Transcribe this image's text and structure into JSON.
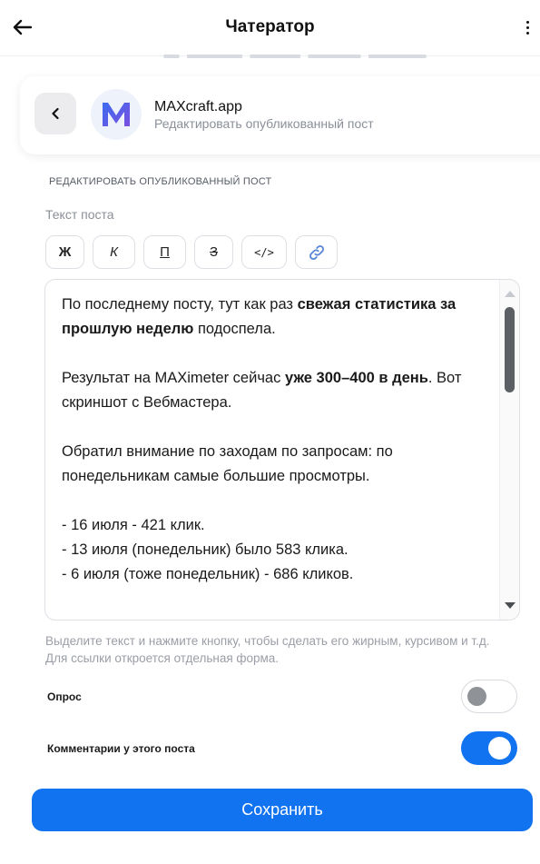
{
  "topbar": {
    "title": "Чатератор",
    "back_icon": "arrow-left-icon",
    "menu_icon": "kebab-menu-icon"
  },
  "card": {
    "back_icon": "chevron-left-icon",
    "logo_icon": "max-logo-icon",
    "name": "MAXcraft.app",
    "subtitle": "Редактировать опубликованный пост"
  },
  "section_label": "РЕДАКТИРОВАТЬ ОПУБЛИКОВАННЫЙ ПОСТ",
  "field_label": "Текст поста",
  "toolbar": {
    "bold": "Ж",
    "italic": "К",
    "underline": "П",
    "strike": "З",
    "code": "</>",
    "link_icon": "link-icon"
  },
  "post": {
    "p1_a": "По последнему посту, тут как раз ",
    "p1_b": "свежая статистика за прошлую неделю",
    "p1_c": " подоспела.",
    "p2_a": "Результат на MAXimeter сейчас ",
    "p2_b": "уже 300–400 в день",
    "p2_c": ". Вот скриншот с Вебмастера.",
    "p3": "Обратил внимание по заходам по запросам: по понедельникам самые большие просмотры.",
    "list": [
      "- 16 июля - 421 клик.",
      "- 13 июля (понедельник) было 583 клика.",
      "- 6 июля (тоже понедельник) - 686 кликов."
    ]
  },
  "hint": "Выделите текст и нажмите кнопку, чтобы сделать его жирным, курсивом и т.д. Для ссылки откроется отдельная форма.",
  "poll": {
    "label": "Опрос",
    "enabled": false
  },
  "comments": {
    "label": "Комментарии у этого поста",
    "enabled": true
  },
  "save_label": "Сохранить",
  "colors": {
    "accent": "#1273f0",
    "logo": "#4a63e8",
    "muted_text": "#8a8f98"
  }
}
